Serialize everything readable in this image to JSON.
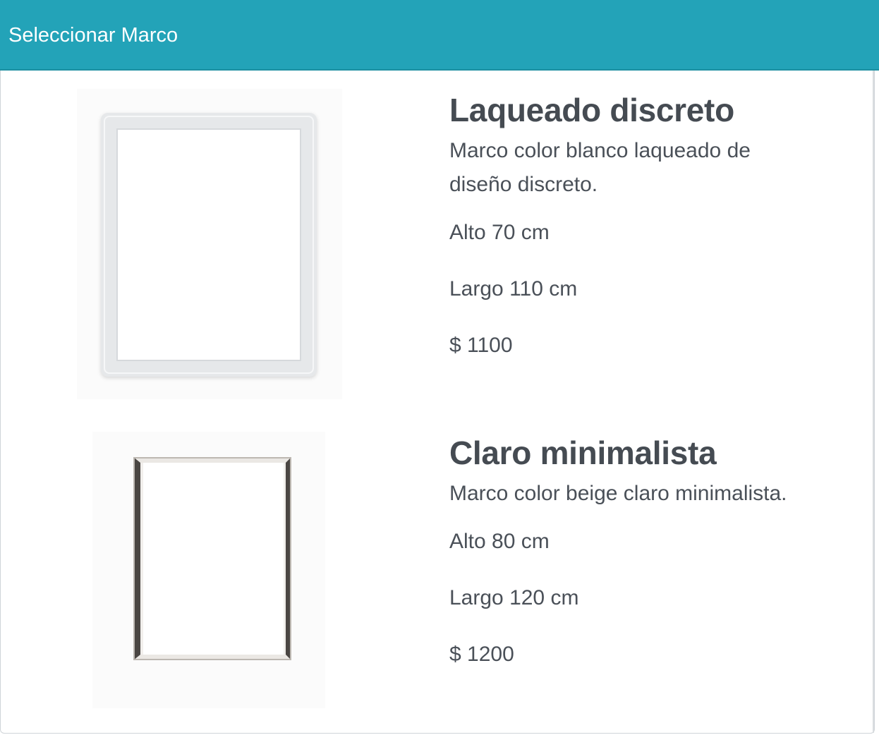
{
  "header": {
    "title": "Seleccionar Marco"
  },
  "products": [
    {
      "name": "Laqueado discreto",
      "description_line1": "Marco color blanco laqueado de",
      "description_line2": "diseño discreto.",
      "alto": "Alto 70 cm",
      "largo": "Largo 110 cm",
      "price": "$ 1100",
      "image_icon": "white-lacquered-frame-image"
    },
    {
      "name": "Claro minimalista",
      "description_line1": "Marco color beige claro minimalista.",
      "alto": "Alto 80 cm",
      "largo": "Largo 120 cm",
      "price": "$ 1200",
      "image_icon": "beige-minimal-frame-image"
    }
  ],
  "colors": {
    "header_bg": "#23a3b8",
    "header_text": "#ffffff",
    "text": "#495057"
  }
}
